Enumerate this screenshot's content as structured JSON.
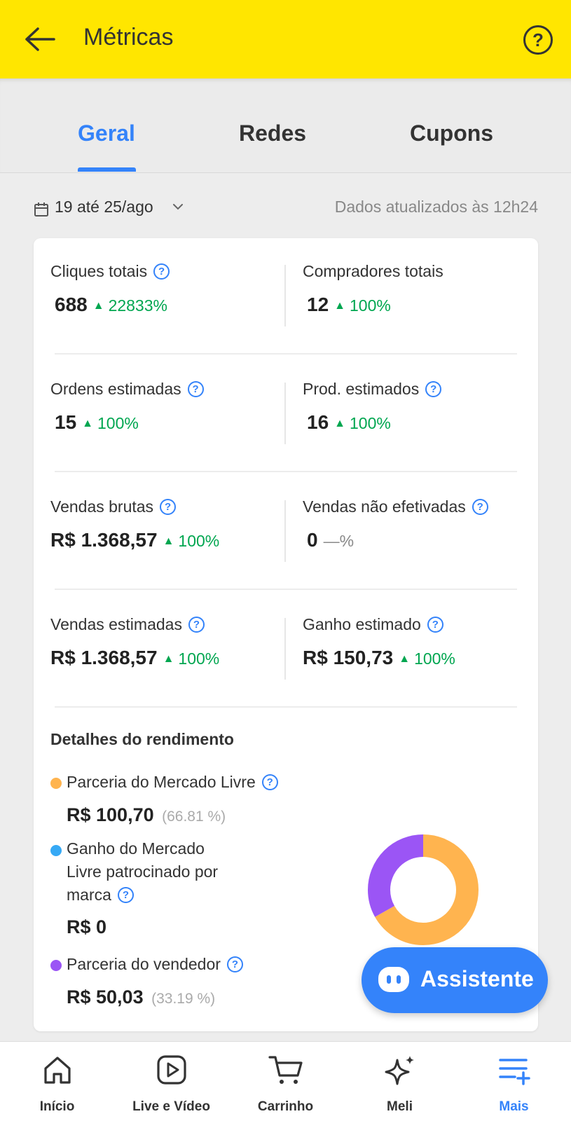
{
  "header": {
    "title": "Métricas",
    "back_icon": "arrow-left-icon",
    "help_icon": "help-circle-icon",
    "help_glyph": "?",
    "background": "#ffe600"
  },
  "tabs": [
    {
      "label": "Geral",
      "active": true
    },
    {
      "label": "Redes",
      "active": false
    },
    {
      "label": "Cupons",
      "active": false
    }
  ],
  "date_range": {
    "label": "19 até 25/ago",
    "updated": "Dados atualizados às 12h24"
  },
  "metrics": [
    {
      "label": "Cliques totais",
      "value": "688",
      "change": "22833%",
      "trend": "▲"
    },
    {
      "label": "Compradores totais",
      "value": "12",
      "change": "100%",
      "trend": "▲"
    },
    {
      "label": "Ordens estimadas",
      "value": "15",
      "change": "100%",
      "trend": "▲"
    },
    {
      "label": "Prod. estimados",
      "value": "16",
      "change": "100%",
      "trend": "▲"
    },
    {
      "label": "Vendas brutas",
      "value": "R$ 1.368,57",
      "change": "100%",
      "trend": "▲"
    },
    {
      "label": "Vendas não efetivadas",
      "value": "0",
      "change": "—%"
    },
    {
      "label": "Vendas estimadas",
      "value": "R$ 1.368,57",
      "change": "100%",
      "trend": "▲"
    },
    {
      "label": "Ganho estimado",
      "value": "R$ 150,73",
      "change": "100%",
      "trend": "▲"
    }
  ],
  "details": {
    "title": "Detalhes do rendimento",
    "items": [
      {
        "label": "Parceria do Mercado Livre",
        "value": "R$ 100,70",
        "percent": "(66.81 %)",
        "color": "#ffb44f"
      },
      {
        "label_lines": [
          "Ganho do Mercado",
          "Livre patrocinado por",
          "marca"
        ],
        "value": "R$ 0",
        "color": "#36a9f5"
      },
      {
        "label": "Parceria do vendedor",
        "value": "R$ 50,03",
        "percent": "(33.19 %)",
        "color": "#9b55f5"
      }
    ],
    "donut": [
      {
        "name": "Parceria do Mercado Livre",
        "fraction": 0.6681,
        "color": "#ffb44f"
      },
      {
        "name": "Parceria do vendedor",
        "fraction": 0.3319,
        "color": "#9b55f5"
      }
    ]
  },
  "assistant": {
    "label": "Assistente",
    "icon": "assistant-bot-icon"
  },
  "bottom_nav": [
    {
      "label": "Início",
      "icon": "home-icon"
    },
    {
      "label": "Live e Vídeo",
      "icon": "play-icon"
    },
    {
      "label": "Carrinho",
      "icon": "cart-icon"
    },
    {
      "label": "Meli",
      "icon": "sparkle-icon"
    },
    {
      "label": "Mais",
      "icon": "menu-plus-icon",
      "active": true
    }
  ]
}
